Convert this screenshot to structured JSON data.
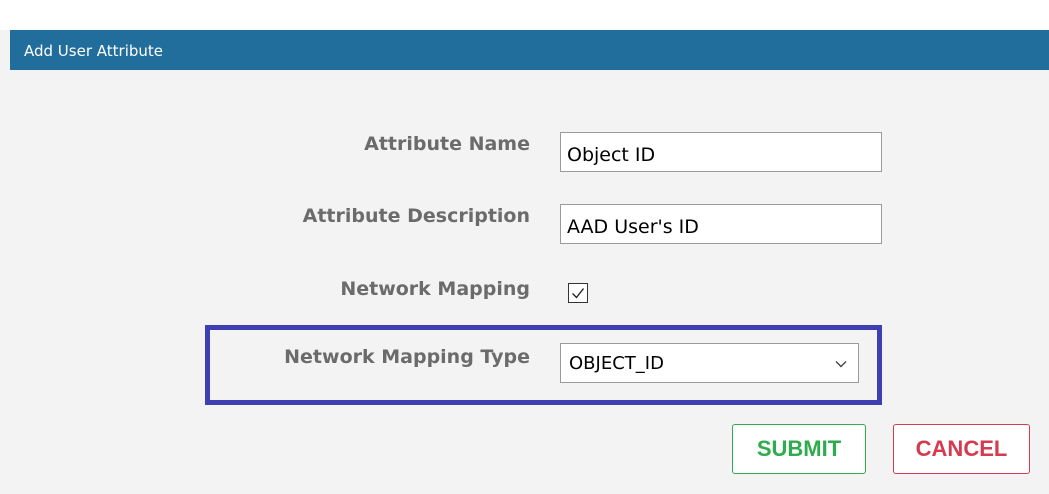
{
  "dialog": {
    "title": "Add User Attribute"
  },
  "form": {
    "attribute_name": {
      "label": "Attribute Name",
      "value": "Object ID"
    },
    "attribute_description": {
      "label": "Attribute Description",
      "value": "AAD User's ID"
    },
    "network_mapping": {
      "label": "Network Mapping",
      "checked": true
    },
    "network_mapping_type": {
      "label": "Network Mapping Type",
      "selected": "OBJECT_ID"
    }
  },
  "buttons": {
    "submit_label": "SUBMIT",
    "cancel_label": "CANCEL"
  },
  "colors": {
    "title_bar": "#216d9c",
    "highlight": "#3d3fb3",
    "submit": "#2eac4e",
    "cancel": "#d63a4e"
  },
  "icons": {
    "checkbox_mark": "checkmark-icon",
    "select_indicator": "chevron-down-icon"
  }
}
